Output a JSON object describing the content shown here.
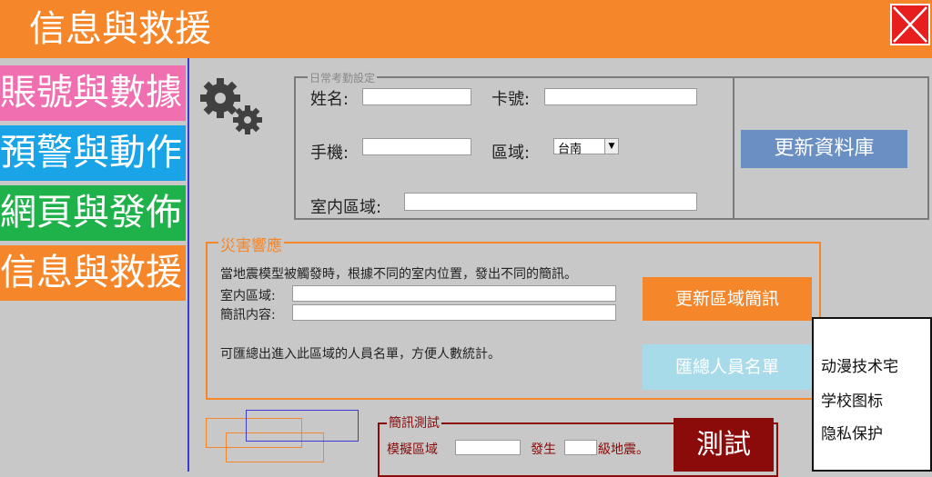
{
  "window": {
    "title": "信息與救援"
  },
  "sidebar": {
    "items": [
      {
        "label": "賬號與數據",
        "color": "#f06fb0"
      },
      {
        "label": "預警與動作",
        "color": "#1aa4e8"
      },
      {
        "label": "網頁與發佈",
        "color": "#1fb24a"
      },
      {
        "label": "信息與救援",
        "color": "#f5862a"
      }
    ]
  },
  "settings": {
    "legend": "日常考勤設定",
    "name_label": "姓名:",
    "name_value": "",
    "card_label": "卡號:",
    "card_value": "",
    "phone_label": "手機:",
    "phone_value": "",
    "region_label": "區域:",
    "region_value": "台南",
    "indoor_label": "室内區域:",
    "indoor_value": "",
    "update_db_button": "更新資料庫"
  },
  "disaster": {
    "legend": "災害響應",
    "description": "當地震模型被觸發時，根據不同的室内位置，發出不同的簡訊。",
    "indoor_label": "室内區域:",
    "indoor_value": "",
    "message_label": "簡訊内容:",
    "message_value": "",
    "update_button": "更新區域簡訊",
    "summary_text": "可匯總出進入此區域的人員名單，方便人數統計。",
    "summary_button": "匯總人員名單"
  },
  "sms_test": {
    "legend": "簡訊測試",
    "simulate_label": "模擬區域",
    "simulate_value": "",
    "occur_label": "發生",
    "magnitude_value": "",
    "magnitude_suffix": "級地震。",
    "test_button": "測試"
  },
  "popup": {
    "lines": [
      "动漫技术宅",
      "学校图标",
      "隐私保护"
    ]
  },
  "colors": {
    "title_bar": "#f5862a",
    "close": "#e81e1e",
    "db_button": "#6a8fc3",
    "orange_button": "#f5862a",
    "summary_button": "#a8dbe9",
    "test_button": "#8b0a0a"
  }
}
